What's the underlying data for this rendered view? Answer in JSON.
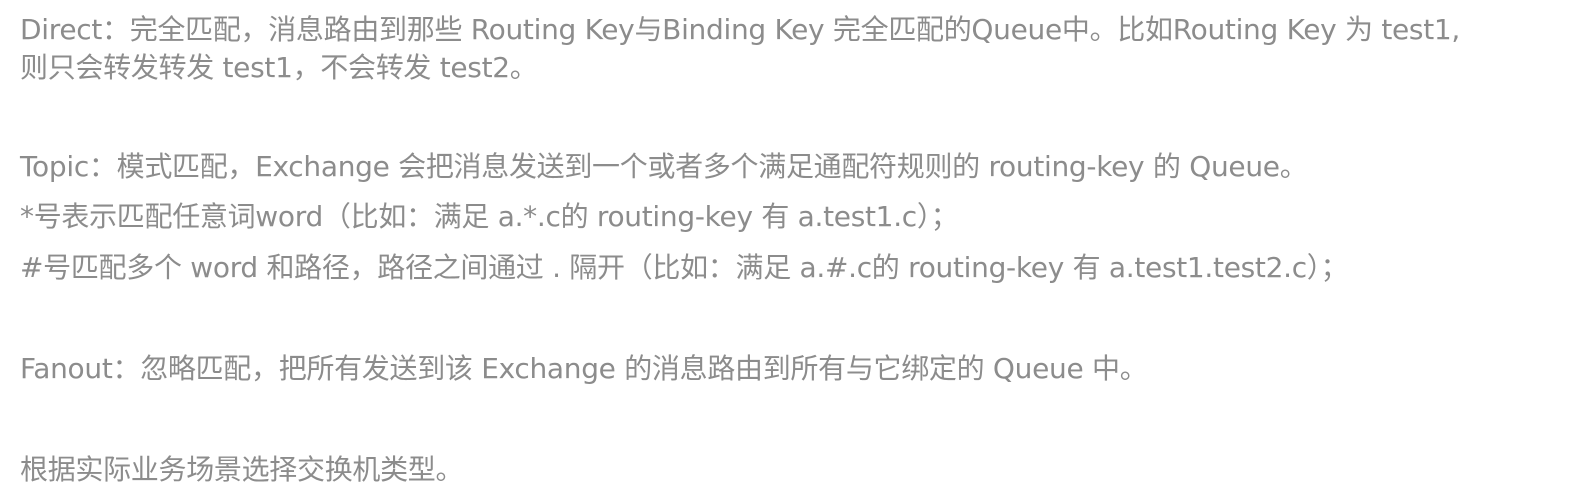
{
  "paragraphs": {
    "direct": {
      "line1": "Direct：完全匹配，消息路由到那些 Routing Key与Binding Key 完全匹配的Queue中。比如Routing Key 为 test1,",
      "line2": "则只会转发转发 test1，不会转发 test2。"
    },
    "topic": {
      "line1": "Topic：模式匹配，Exchange 会把消息发送到一个或者多个满足通配符规则的 routing-key 的 Queue。",
      "line2": "*号表示匹配任意词word（比如：满足 a.*.c的 routing-key 有 a.test1.c）；",
      "line3": "#号匹配多个 word 和路径，路径之间通过 . 隔开（比如：满足 a.#.c的 routing-key 有 a.test1.test2.c）；"
    },
    "fanout": {
      "line1": "Fanout：忽略匹配，把所有发送到该 Exchange 的消息路由到所有与它绑定的 Queue 中。"
    },
    "conclusion": {
      "line1": "根据实际业务场景选择交换机类型。"
    }
  },
  "colors": {
    "text": "#8c8c8c",
    "background": "#ffffff"
  }
}
